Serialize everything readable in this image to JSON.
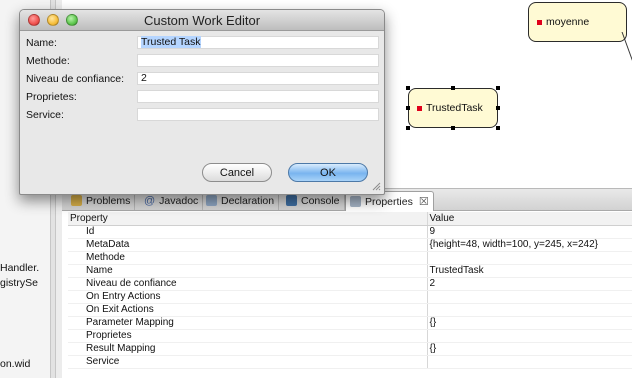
{
  "dialog": {
    "title": "Custom Work Editor",
    "fields": [
      {
        "label": "Name:",
        "value": "Trusted Task"
      },
      {
        "label": "Methode:",
        "value": ""
      },
      {
        "label": "Niveau de confiance:",
        "value": "2"
      },
      {
        "label": "Proprietes:",
        "value": ""
      },
      {
        "label": "Service:",
        "value": ""
      }
    ],
    "cancel_label": "Cancel",
    "ok_label": "OK"
  },
  "left_panel": {
    "items": [
      "Handler.",
      "gistrySe",
      "on.wid"
    ]
  },
  "canvas": {
    "nodes": [
      {
        "label": "moyenne"
      },
      {
        "label": "TrustedTask"
      }
    ]
  },
  "views": {
    "tabs": [
      {
        "label": "Problems",
        "icon": "problems-icon"
      },
      {
        "label": "Javadoc",
        "icon": "at-sign-icon"
      },
      {
        "label": "Declaration",
        "icon": "declaration-icon"
      },
      {
        "label": "Console",
        "icon": "console-icon"
      },
      {
        "label": "Properties",
        "icon": "properties-icon",
        "active": true,
        "close": "☒"
      }
    ],
    "properties": {
      "columns": [
        "Property",
        "Value"
      ],
      "rows": [
        {
          "property": "Id",
          "value": "9"
        },
        {
          "property": "MetaData",
          "value": "{height=48, width=100, y=245, x=242}"
        },
        {
          "property": "Methode",
          "value": ""
        },
        {
          "property": "Name",
          "value": "TrustedTask"
        },
        {
          "property": "Niveau de confiance",
          "value": "2"
        },
        {
          "property": "On Entry Actions",
          "value": ""
        },
        {
          "property": "On Exit Actions",
          "value": ""
        },
        {
          "property": "Parameter Mapping",
          "value": "{}"
        },
        {
          "property": "Proprietes",
          "value": ""
        },
        {
          "property": "Result Mapping",
          "value": "{}"
        },
        {
          "property": "Service",
          "value": ""
        }
      ]
    }
  },
  "colors": {
    "node_fill": "#fffad4",
    "node_marker": "#e0001b",
    "ok_button": "#79b4ef",
    "close_traffic": "#f0524f",
    "minimize_traffic": "#f6be3b",
    "zoom_traffic": "#5fc84f"
  }
}
